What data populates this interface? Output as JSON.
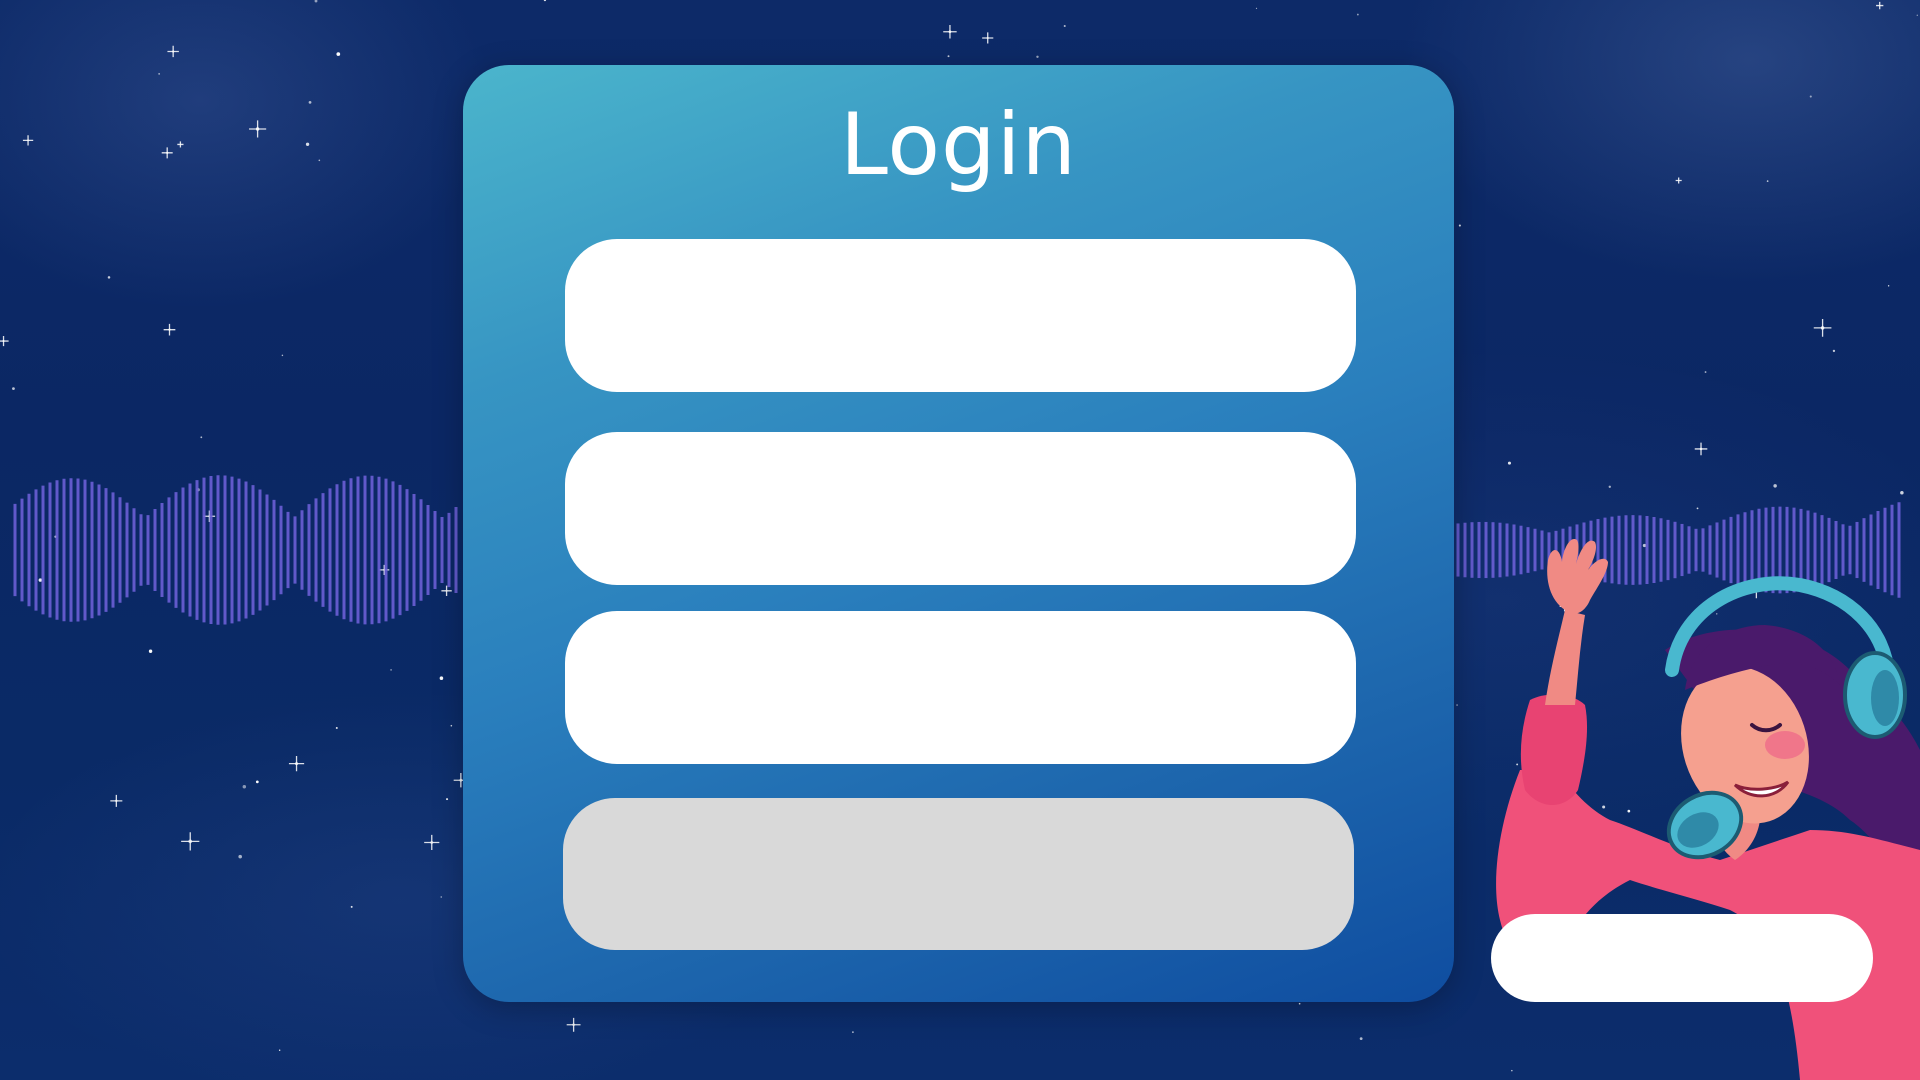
{
  "login_form": {
    "title": "Login",
    "username_value": "",
    "email_value": "",
    "password_value": "",
    "submit_label": ""
  },
  "side_button": {
    "label": ""
  },
  "colors": {
    "background": "#0b2764",
    "card_top_left": "#4bb5cc",
    "card_bottom_right": "#0f4da0",
    "input_fill": "#ffffff",
    "submit_fill": "#d9d9d9",
    "wave_color": "#6b5fd6",
    "shirt_pink": "#f0517a",
    "headphone_teal": "#49b8cf",
    "hair_purple": "#4a1a6b"
  },
  "illustration": {
    "subject": "girl-with-headphones-icon",
    "decoration": "audio-waveform-icon"
  }
}
